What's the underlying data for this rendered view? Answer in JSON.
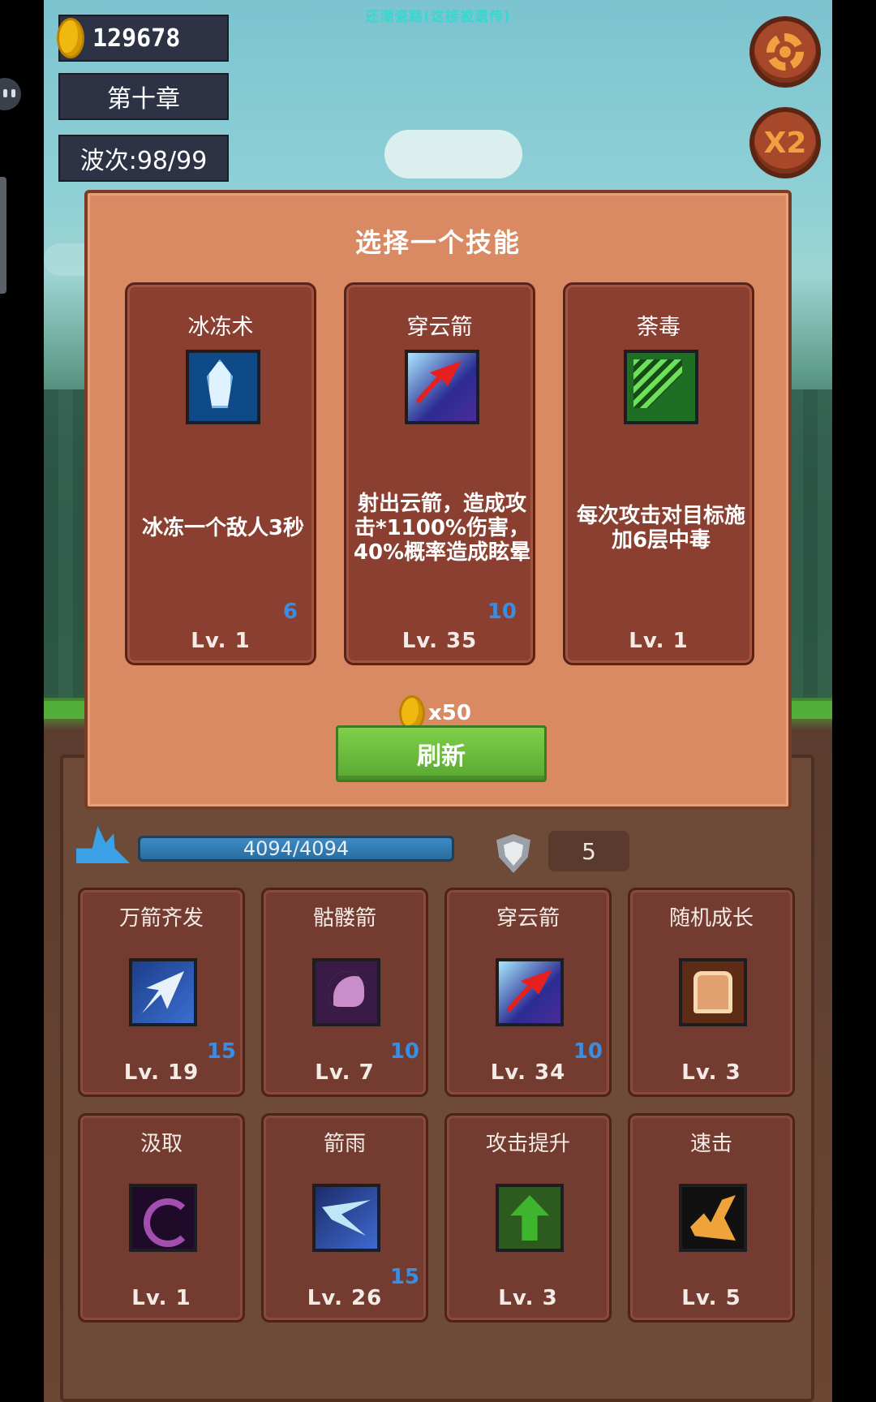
{
  "watermark": "还潮瓷路(这接被遗传)",
  "hud": {
    "coins": "129678",
    "chapter": "第十章",
    "wave": "波次:98/99",
    "speed_label": "X2"
  },
  "status": {
    "hp_text": "4094/4094",
    "hp_fraction": 1.0,
    "armor": "5"
  },
  "skills": [
    {
      "name": "万箭齐发",
      "level": "Lv. 19",
      "count": "15",
      "icon": "arrow-volley-icon"
    },
    {
      "name": "骷髅箭",
      "level": "Lv. 7",
      "count": "10",
      "icon": "skull-arrow-icon"
    },
    {
      "name": "穿云箭",
      "level": "Lv. 34",
      "count": "10",
      "icon": "cloud-piercing-arrow-icon"
    },
    {
      "name": "随机成长",
      "level": "Lv. 3",
      "count": "",
      "icon": "random-growth-icon"
    },
    {
      "name": "汲取",
      "level": "Lv. 1",
      "count": "",
      "icon": "drain-vortex-icon"
    },
    {
      "name": "箭雨",
      "level": "Lv. 26",
      "count": "15",
      "icon": "arrow-rain-icon"
    },
    {
      "name": "攻击提升",
      "level": "Lv. 3",
      "count": "",
      "icon": "attack-up-arrow-icon"
    },
    {
      "name": "速击",
      "level": "Lv. 5",
      "count": "",
      "icon": "quick-strike-icon"
    }
  ],
  "modal": {
    "title": "选择一个技能",
    "choices": [
      {
        "name": "冰冻术",
        "desc": "冰冻一个敌人3秒",
        "count": "6",
        "level": "Lv. 1",
        "icon": "ice-crystal-icon"
      },
      {
        "name": "穿云箭",
        "desc": "射出云箭，造成攻击*1100%伤害，40%概率造成眩晕",
        "count": "10",
        "level": "Lv. 35",
        "icon": "cloud-piercing-arrow-icon"
      },
      {
        "name": "荼毒",
        "desc": "每次攻击对目标施加6层中毒",
        "count": "",
        "level": "Lv. 1",
        "icon": "poison-icon"
      }
    ],
    "refresh_cost": "x50",
    "refresh_label": "刷新"
  }
}
